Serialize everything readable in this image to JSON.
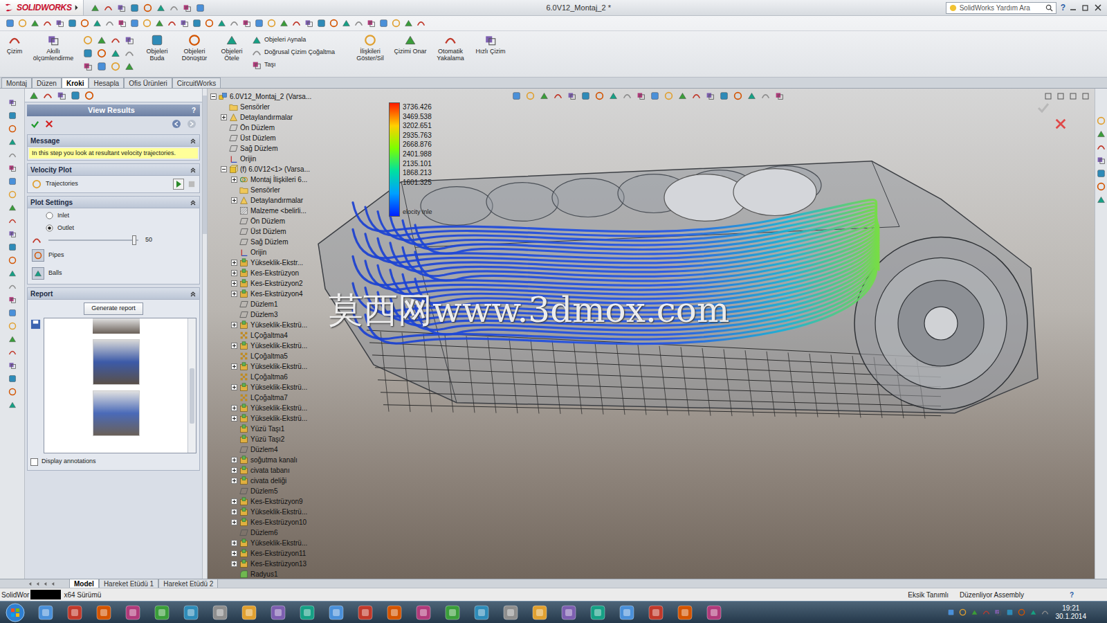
{
  "app": {
    "logo": "SOLIDWORKS",
    "title": "6.0V12_Montaj_2 *",
    "search_placeholder": "SolidWorks Yardım Ara",
    "help": "?"
  },
  "ribbon": {
    "left": [
      "Çizim",
      "Akıllı ölçümlendirme"
    ],
    "middle": [
      "Objeleri Buda",
      "Objeleri Dönüştür",
      "Objeleri Ötele"
    ],
    "stack": [
      "Objeleri Aynala",
      "Doğrusal Çizim Çoğaltma",
      "Taşı"
    ],
    "right": [
      "İlişkileri Göster/Sil",
      "Çizimi Onar",
      "Otomatik Yakalama",
      "Hızlı Çizim"
    ]
  },
  "tabs": [
    {
      "label": "Montaj",
      "selected": false
    },
    {
      "label": "Düzen",
      "selected": false
    },
    {
      "label": "Kroki",
      "selected": true
    },
    {
      "label": "Hesapla",
      "selected": false
    },
    {
      "label": "Ofis Ürünleri",
      "selected": false
    },
    {
      "label": "CircuitWorks",
      "selected": false
    }
  ],
  "property_manager": {
    "title": "View Results",
    "help": "?",
    "message_header": "Message",
    "message": "In this step you look at resultant velocity trajectories.",
    "velocity_header": "Velocity Plot",
    "trajectories": "Trajectories",
    "plot_header": "Plot Settings",
    "radios": [
      {
        "label": "Inlet",
        "selected": false
      },
      {
        "label": "Outlet",
        "selected": true
      }
    ],
    "slider": {
      "level": 0.95,
      "reading": "50"
    },
    "options": [
      "Pipes",
      "Balls"
    ],
    "report_header": "Report",
    "generate": "Generate report",
    "display_annotations": {
      "label": "Display annotations",
      "checked": false
    }
  },
  "tree": [
    {
      "label": "6.0V12_Montaj_2 (Varsa...",
      "level": 0,
      "kind": "assembly",
      "expandable": true,
      "expanded": true
    },
    {
      "label": "Sensörler",
      "level": 1,
      "kind": "folder",
      "expandable": false,
      "expanded": false
    },
    {
      "label": "Detaylandırmalar",
      "level": 1,
      "kind": "annotation",
      "expandable": true,
      "expanded": false
    },
    {
      "label": "Ön Düzlem",
      "level": 1,
      "kind": "plane",
      "expandable": false,
      "expanded": false
    },
    {
      "label": "Üst Düzlem",
      "level": 1,
      "kind": "plane",
      "expandable": false,
      "expanded": false
    },
    {
      "label": "Sağ Düzlem",
      "level": 1,
      "kind": "plane",
      "expandable": false,
      "expanded": false
    },
    {
      "label": "Orijin",
      "level": 1,
      "kind": "origin",
      "expandable": false,
      "expanded": false
    },
    {
      "label": "(f) 6.0V12<1> (Varsa...",
      "level": 1,
      "kind": "part",
      "expandable": true,
      "expanded": true
    },
    {
      "label": "Montaj İlişkileri 6...",
      "level": 2,
      "kind": "mates",
      "expandable": true,
      "expanded": false
    },
    {
      "label": "Sensörler",
      "level": 2,
      "kind": "folder",
      "expandable": false,
      "expanded": false
    },
    {
      "label": "Detaylandırmalar",
      "level": 2,
      "kind": "annotation",
      "expandable": true,
      "expanded": false
    },
    {
      "label": "Malzeme <belirli...",
      "level": 2,
      "kind": "material",
      "expandable": false,
      "expanded": false
    },
    {
      "label": "Ön Düzlem",
      "level": 2,
      "kind": "plane",
      "expandable": false,
      "expanded": false
    },
    {
      "label": "Üst Düzlem",
      "level": 2,
      "kind": "plane",
      "expandable": false,
      "expanded": false
    },
    {
      "label": "Sağ Düzlem",
      "level": 2,
      "kind": "plane",
      "expandable": false,
      "expanded": false
    },
    {
      "label": "Orijin",
      "level": 2,
      "kind": "origin",
      "expandable": false,
      "expanded": false
    },
    {
      "label": "Yükseklik-Ekstr...",
      "level": 2,
      "kind": "feature",
      "expandable": true,
      "expanded": false
    },
    {
      "label": "Kes-Ekstrüzyon",
      "level": 2,
      "kind": "feature",
      "expandable": true,
      "expanded": false
    },
    {
      "label": "Kes-Ekstrüzyon2",
      "level": 2,
      "kind": "feature",
      "expandable": true,
      "expanded": false
    },
    {
      "label": "Kes-Ekstrüzyon4",
      "level": 2,
      "kind": "feature",
      "expandable": true,
      "expanded": false
    },
    {
      "label": "Düzlem1",
      "level": 2,
      "kind": "plane",
      "expandable": false,
      "expanded": false
    },
    {
      "label": "Düzlem3",
      "level": 2,
      "kind": "plane",
      "expandable": false,
      "expanded": false
    },
    {
      "label": "Yükseklik-Ekstrü...",
      "level": 2,
      "kind": "feature",
      "expandable": true,
      "expanded": false
    },
    {
      "label": "LÇoğaltma4",
      "level": 2,
      "kind": "pattern",
      "expandable": false,
      "expanded": false
    },
    {
      "label": "Yükseklik-Ekstrü...",
      "level": 2,
      "kind": "feature",
      "expandable": true,
      "expanded": false
    },
    {
      "label": "LÇoğaltma5",
      "level": 2,
      "kind": "pattern",
      "expandable": false,
      "expanded": false
    },
    {
      "label": "Yükseklik-Ekstrü...",
      "level": 2,
      "kind": "feature",
      "expandable": true,
      "expanded": false
    },
    {
      "label": "LÇoğaltma6",
      "level": 2,
      "kind": "pattern",
      "expandable": false,
      "expanded": false
    },
    {
      "label": "Yükseklik-Ekstrü...",
      "level": 2,
      "kind": "feature",
      "expandable": true,
      "expanded": false
    },
    {
      "label": "LÇoğaltma7",
      "level": 2,
      "kind": "pattern",
      "expandable": false,
      "expanded": false
    },
    {
      "label": "Yükseklik-Ekstrü...",
      "level": 2,
      "kind": "feature",
      "expandable": true,
      "expanded": false
    },
    {
      "label": "Yükseklik-Ekstrü...",
      "level": 2,
      "kind": "feature",
      "expandable": true,
      "expanded": false
    },
    {
      "label": "Yüzü Taşı1",
      "level": 2,
      "kind": "feature",
      "expandable": false,
      "expanded": false
    },
    {
      "label": "Yüzü Taşı2",
      "level": 2,
      "kind": "feature",
      "expandable": false,
      "expanded": false
    },
    {
      "label": "Düzlem4",
      "level": 2,
      "kind": "plane",
      "expandable": false,
      "expanded": false
    },
    {
      "label": "soğutma kanalı",
      "level": 2,
      "kind": "feature",
      "expandable": true,
      "expanded": false
    },
    {
      "label": "civata tabanı",
      "level": 2,
      "kind": "feature",
      "expandable": true,
      "expanded": false
    },
    {
      "label": "civata deliği",
      "level": 2,
      "kind": "feature",
      "expandable": true,
      "expanded": false
    },
    {
      "label": "Düzlem5",
      "level": 2,
      "kind": "plane",
      "expandable": false,
      "expanded": false
    },
    {
      "label": "Kes-Ekstrüzyon9",
      "level": 2,
      "kind": "feature",
      "expandable": true,
      "expanded": false
    },
    {
      "label": "Yükseklik-Ekstrü...",
      "level": 2,
      "kind": "feature",
      "expandable": true,
      "expanded": false
    },
    {
      "label": "Kes-Ekstrüzyon10",
      "level": 2,
      "kind": "feature",
      "expandable": true,
      "expanded": false
    },
    {
      "label": "Düzlem6",
      "level": 2,
      "kind": "plane",
      "expandable": false,
      "expanded": false
    },
    {
      "label": "Yükseklik-Ekstrü...",
      "level": 2,
      "kind": "feature",
      "expandable": true,
      "expanded": false
    },
    {
      "label": "Kes-Ekstrüzyon11",
      "level": 2,
      "kind": "feature",
      "expandable": true,
      "expanded": false
    },
    {
      "label": "Kes-Ekstrüzyon13",
      "level": 2,
      "kind": "feature",
      "expandable": true,
      "expanded": false
    },
    {
      "label": "Radyus1",
      "level": 2,
      "kind": "fillet",
      "expandable": false,
      "expanded": false
    }
  ],
  "legend": {
    "values": [
      "3736.426",
      "3469.538",
      "3202.651",
      "2935.763",
      "2668.876",
      "2401.988",
      "2135.101",
      "1868.213",
      "1601.325"
    ],
    "caption": "elocity Inle"
  },
  "watermark": "莫西网www.3dmox.com",
  "bottom_tabs": [
    {
      "label": "Model",
      "selected": true
    },
    {
      "label": "Hareket Etüdü 1",
      "selected": false
    },
    {
      "label": "Hareket Etüdü 2",
      "selected": false
    }
  ],
  "status_bar": {
    "left": "SolidWor",
    "version": "x64 Sürümü",
    "state": "Eksik Tanımlı",
    "mode": "Düzenliyor Assembly",
    "help": "?"
  },
  "taskbar": {
    "time": "19:21",
    "date": "30.1.2014"
  }
}
